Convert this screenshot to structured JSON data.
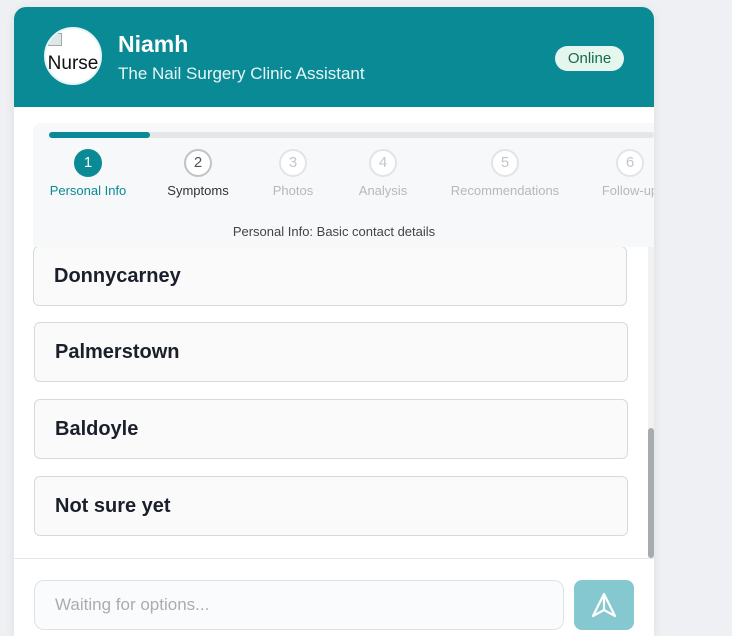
{
  "header": {
    "avatar_alt": "Nurse",
    "name": "Niamh",
    "subtitle": "The Nail Surgery Clinic Assistant",
    "status": "Online"
  },
  "progress": {
    "fraction": 0.167,
    "steps": [
      {
        "number": "1",
        "label": "Personal Info",
        "state": "active"
      },
      {
        "number": "2",
        "label": "Symptoms",
        "state": "next"
      },
      {
        "number": "3",
        "label": "Photos",
        "state": "upcoming"
      },
      {
        "number": "4",
        "label": "Analysis",
        "state": "upcoming"
      },
      {
        "number": "5",
        "label": "Recommendations",
        "state": "upcoming"
      },
      {
        "number": "6",
        "label": "Follow-up",
        "state": "upcoming"
      }
    ],
    "description": "Personal Info: Basic contact details"
  },
  "options": [
    "Donnycarney",
    "Palmerstown",
    "Baldoyle",
    "Not sure yet"
  ],
  "input": {
    "placeholder": "Waiting for options..."
  },
  "icons": {
    "send": "send-icon"
  },
  "colors": {
    "brand": "#0a8a95",
    "status_bg": "#e5f6ee",
    "send_disabled": "#86c8cf"
  }
}
